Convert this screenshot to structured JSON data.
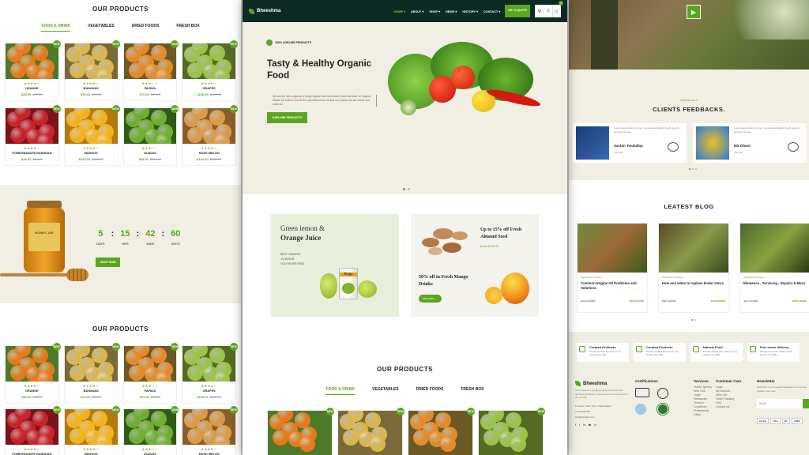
{
  "left": {
    "products_title": "OUR PRODUCTS",
    "tabs": [
      "FOOD & DRINK",
      "VEGETABLES",
      "DRIED FOODS",
      "FRESH BOX"
    ],
    "products": [
      {
        "name": "ORANGE",
        "price": "$30.00",
        "old": "$40.00",
        "badge": "NEW",
        "rating": "★★★★☆",
        "color": "#e8781c",
        "bg": "#4c7a2a"
      },
      {
        "name": "BANANAS",
        "price": "$70.00",
        "old": "$90.00",
        "badge": "NEW",
        "rating": "★★★★☆",
        "color": "#d9b64f",
        "bg": "#7a6a3a"
      },
      {
        "name": "PAPAYA",
        "price": "$70.00",
        "old": "$90.00",
        "badge": "NEW",
        "rating": "★★★☆☆",
        "color": "#e58a28",
        "bg": "#6b5a26"
      },
      {
        "name": "GRAPES",
        "price": "$150.00",
        "old": "$190.00",
        "badge": "NEW",
        "rating": "★★★★☆",
        "color": "#9bc24a",
        "bg": "#556a22"
      },
      {
        "name": "POMEGRANATE RANDHAN",
        "price": "$30.00",
        "old": "$40.00",
        "badge": "NEW",
        "rating": "★★★★☆",
        "color": "#c8222a",
        "bg": "#7a1418"
      },
      {
        "name": "MANGOS",
        "price": "$130.00",
        "old": "$150.00",
        "badge": "NEW",
        "rating": "★★★★☆",
        "color": "#f2b31d",
        "bg": "#b07a10"
      },
      {
        "name": "GUAVAS",
        "price": "$85.00",
        "old": "$110.00",
        "badge": "NEW",
        "rating": "★★★☆☆",
        "color": "#6fae2f",
        "bg": "#2f5a18"
      },
      {
        "name": "MUSK MELON",
        "price": "$120.00",
        "old": "$150.00",
        "badge": "NEW",
        "rating": "★★★★☆",
        "color": "#d99a4a",
        "bg": "#8a5e2a"
      }
    ],
    "countdown": [
      {
        "v": "5",
        "l": "DAYS"
      },
      {
        "v": "15",
        "l": "HRS"
      },
      {
        "v": "42",
        "l": "MINS"
      },
      {
        "v": "60",
        "l": "SECS"
      }
    ],
    "shop_now": "SHOP NOW",
    "honey_label": "HONEY JAR",
    "products_title2": "OUR PRODUCTS"
  },
  "center": {
    "brand": "Bheeshma",
    "nav": [
      "HOME ▾",
      "ABOUT ▾",
      "SHOP ▾",
      "NEWS ▾",
      "HISTORY ▾",
      "CONTACT ▾"
    ],
    "quote_button": "GET A QUOTE",
    "cart_count": "0",
    "hero_tag": "100% AGRLINE PRODUCTS",
    "hero_title_1": "Tasty & Healthy Organic",
    "hero_title_2": "Food",
    "hero_text": "We are the first company to bring Organic food into India's home kitchens. At Organic Basket we believe food is the nourishment for not just our bodies, but our minds and souls too.",
    "hero_button": "EXPLORE PRODUCTS",
    "promo1_title_1": "Green lemon &",
    "promo1_title_2": "Orange Juice",
    "promo1_sub": [
      "BEST ORANGE",
      "-FLAVOUR",
      "YOU NEVER MISS"
    ],
    "promo1_can": "Rage",
    "promo2_title": "Up to 15% off Fresh Almond Seed",
    "promo2_price": "from 60.99 $",
    "promo3_title": "50% off in Fresh Mango Drinks",
    "promo3_button": "Shop Now →",
    "products_title": "OUR PRODUCTS",
    "tabs": [
      "FOOD & DRINK",
      "VEGETABLES",
      "DRIED FOODS",
      "FRESH BOX"
    ],
    "bottom_badges": [
      "NEW",
      "NEW",
      "NEW",
      "NEW"
    ]
  },
  "right": {
    "feedback_small": "TESTIMONIALS",
    "feedback_title": "CLIENTS FEEDBACKS.",
    "testimonials": [
      {
        "text": "Lorem ipsum dolor sit amet, consectetur adipiscing elit, sed do eiusmod tempor.",
        "name": "Sachin Tendulkar",
        "role": "Founder"
      },
      {
        "text": "Lorem ipsum dolor sit amet, consectetur adipiscing elit, sed do eiusmod tempor.",
        "name": "MS Dhoni",
        "role": "Founder"
      }
    ],
    "blog_title": "LEATEST BLOG",
    "blogs": [
      {
        "meta": "Agriculture  Services",
        "title": "Common Engine Oil Problems and Solutions.",
        "date": "June 24,2020",
        "more": "READ MORE"
      },
      {
        "meta": "Agriculture  Services",
        "title": "How and when to replace brake rotors",
        "date": "May 24,2022",
        "more": "READ MORE"
      },
      {
        "meta": "Agriculture  Services",
        "title": "Elemence , Servicing , Repairs & More",
        "date": "June 24,2019",
        "more": "READ MORE"
      }
    ],
    "features": [
      {
        "title": "Curated Products",
        "text": "Provide Curated Products for all product over $99"
      },
      {
        "title": "Curated Products",
        "text": "Provide Curated Products for all product over $99"
      },
      {
        "title": "Natural Food",
        "text": "Provide natural pilot a basis for any product over $99"
      },
      {
        "title": "Free home delivery",
        "text": "Provide free home delivery for all product over $99"
      }
    ],
    "footer_brand": "Bheeshma",
    "footer_about": "Lorem ipsum is simply dummy text of the and typesetting industry. Lorem ipsum is dummy text of the printing.",
    "footer_address": "8 Jordan, New York, United States",
    "footer_phone": "+123 456 789",
    "footer_email": "info@website.com",
    "certifications": "Certifications",
    "services": "Services.",
    "services_list": [
      "Home Lighting",
      "Web Link",
      "Legal",
      "Restaurant",
      "Terms &",
      "Conditions",
      "Professional",
      "Office"
    ],
    "customer_care": "Customer Care",
    "care_list": [
      "Login",
      "My Account",
      "Wish List",
      "Order Tracking",
      "FAQ",
      "Contact Us"
    ],
    "newsletter": "Newsletter",
    "newsletter_text": "Subscribe to our weekly Newsletter and receive updates via email.",
    "newsletter_placeholder": "Email",
    "payments": [
      "PayPal",
      "VISA",
      "MC",
      "AMEX"
    ]
  },
  "colors": {
    "accent": "#5aa61e",
    "header": "#0d2a24",
    "cream": "#f1efe4"
  }
}
